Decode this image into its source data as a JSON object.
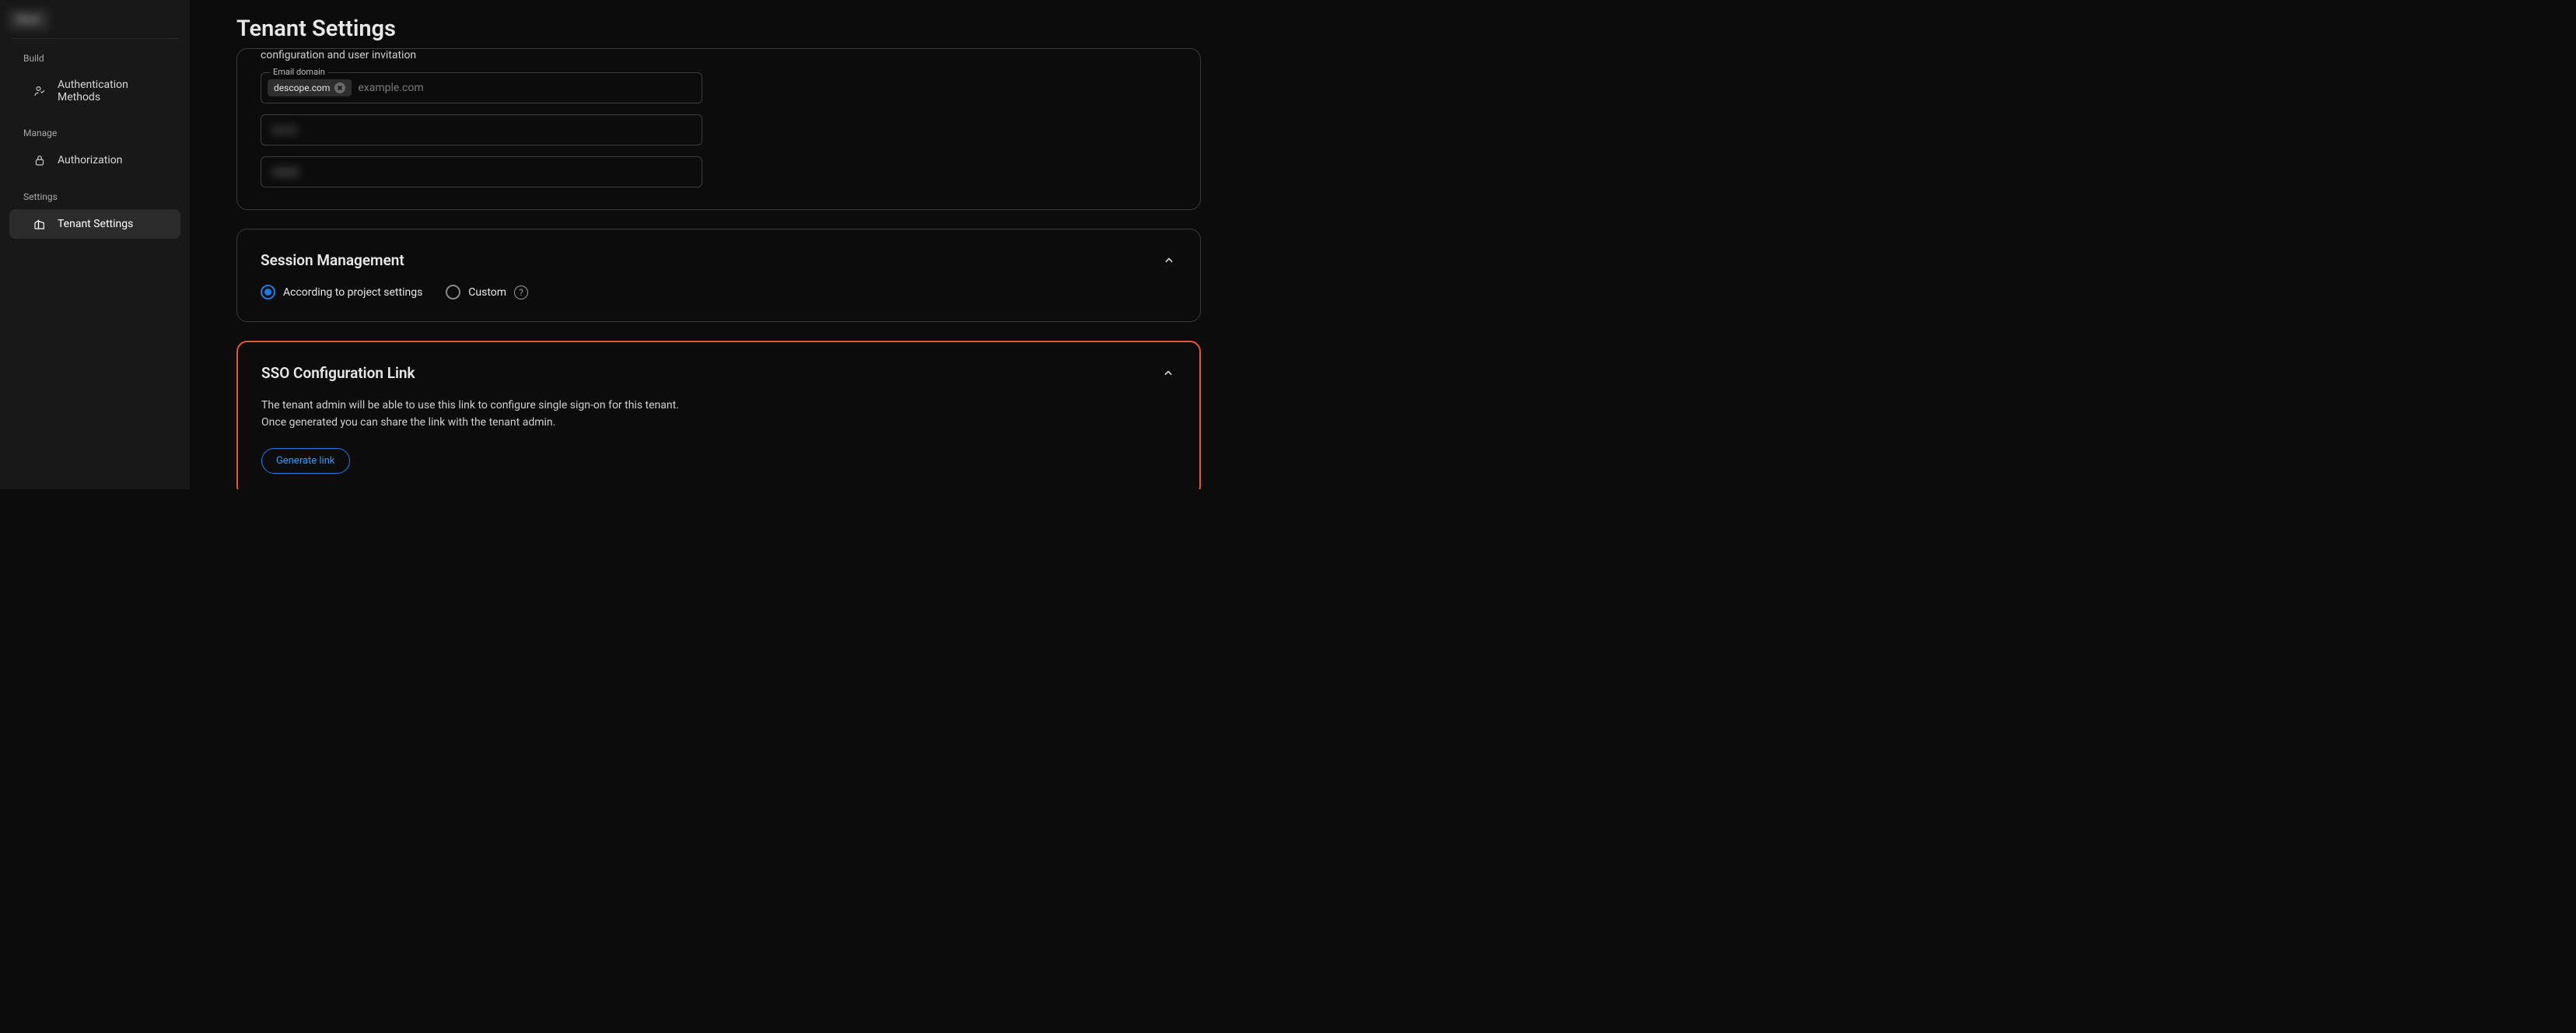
{
  "sidebar": {
    "back_label": "Back",
    "sections": {
      "build": {
        "label": "Build",
        "items": [
          {
            "label": "Authentication Methods"
          }
        ]
      },
      "manage": {
        "label": "Manage",
        "items": [
          {
            "label": "Authorization"
          }
        ]
      },
      "settings": {
        "label": "Settings",
        "items": [
          {
            "label": "Tenant Settings"
          }
        ]
      }
    }
  },
  "page": {
    "title": "Tenant Settings"
  },
  "email_domain": {
    "truncated_line": "configuration and user invitation",
    "legend": "Email domain",
    "chip": "descope.com",
    "placeholder": "example.com",
    "blur1": "xx xx",
    "blur2": "xxxxx"
  },
  "session": {
    "title": "Session Management",
    "opt_project": "According to project settings",
    "opt_custom": "Custom"
  },
  "sso": {
    "title": "SSO Configuration Link",
    "description": "The tenant admin will be able to use this link to configure single sign-on for this tenant. Once generated you can share the link with the tenant admin.",
    "button": "Generate link"
  }
}
